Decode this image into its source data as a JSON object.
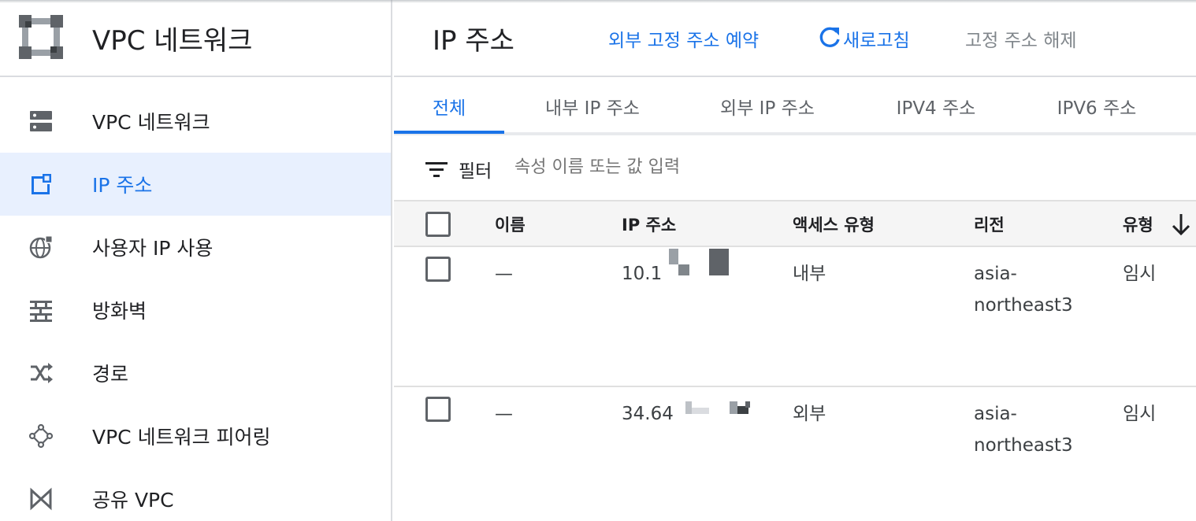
{
  "sidebar": {
    "product_title": "VPC 네트워크",
    "items": [
      {
        "label": "VPC 네트워크",
        "icon": "vpc-network-icon"
      },
      {
        "label": "IP 주소",
        "icon": "ip-address-icon",
        "active": true
      },
      {
        "label": "사용자 IP 사용",
        "icon": "globe-icon"
      },
      {
        "label": "방화벽",
        "icon": "firewall-icon"
      },
      {
        "label": "경로",
        "icon": "routes-icon"
      },
      {
        "label": "VPC 네트워크 피어링",
        "icon": "peering-icon"
      },
      {
        "label": "공유 VPC",
        "icon": "shared-vpc-icon"
      }
    ]
  },
  "header": {
    "title": "IP 주소",
    "reserve_label": "외부 고정 주소 예약",
    "refresh_label": "새로고침",
    "release_label": "고정 주소 해제"
  },
  "tabs": [
    "전체",
    "내부 IP 주소",
    "외부 IP 주소",
    "IPV4 주소",
    "IPV6 주소"
  ],
  "filter": {
    "label": "필터",
    "placeholder": "속성 이름 또는 값 입력"
  },
  "table": {
    "columns": [
      "이름",
      "IP 주소",
      "액세스 유형",
      "리전",
      "유형"
    ],
    "rows": [
      {
        "name": "—",
        "ip": "10.1",
        "access": "내부",
        "region": "asia-northeast3",
        "type": "임시"
      },
      {
        "name": "—",
        "ip": "34.64",
        "access": "외부",
        "region": "asia-northeast3",
        "type": "임시"
      }
    ]
  },
  "colors": {
    "accent": "#1a73e8",
    "active_bg": "#e8f0fe",
    "divider": "#dadce0",
    "icon": "#5f6368"
  }
}
